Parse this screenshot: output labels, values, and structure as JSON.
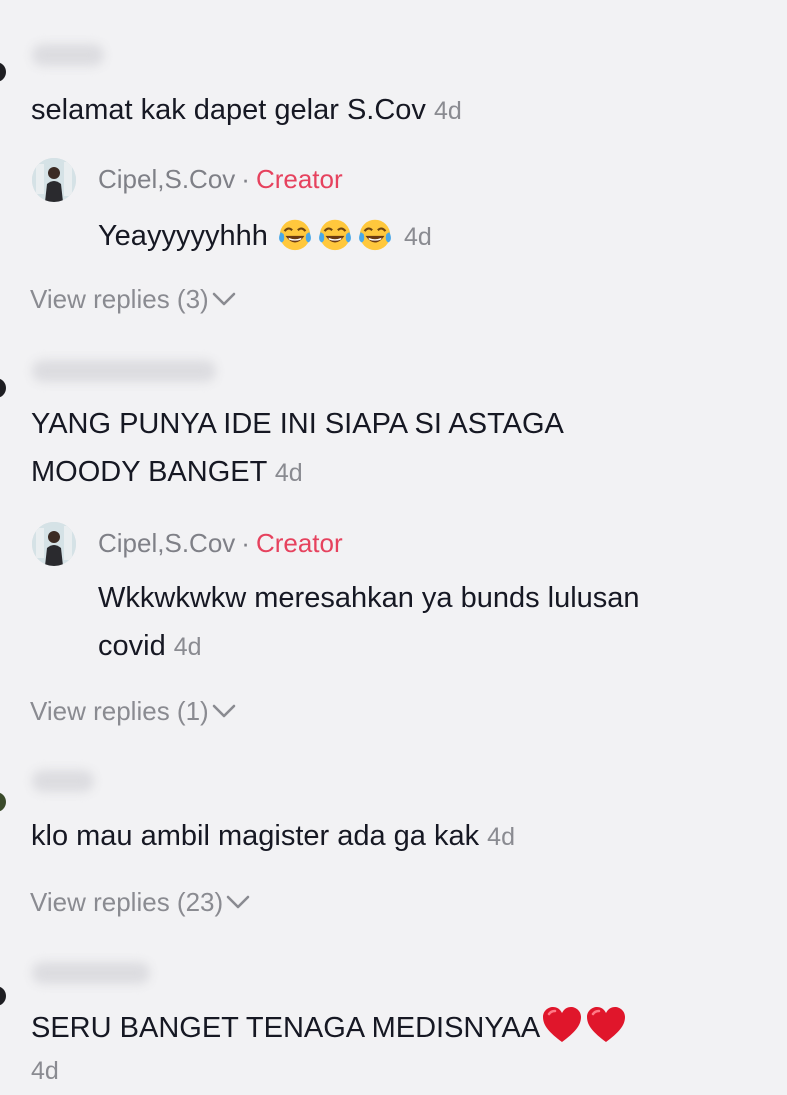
{
  "comments": [
    {
      "text": "selamat kak dapet gelar S.Cov",
      "time": "4d",
      "reply": {
        "author": "Cipel,S.Cov",
        "separator": "·",
        "badge": "Creator",
        "text": "Yeayyyyyhhh",
        "time": "4d"
      },
      "view_replies": "View replies (3)"
    },
    {
      "text_line1": "YANG PUNYA IDE INI SIAPA SI ASTAGA",
      "text_line2": "MOODY BANGET",
      "time": "4d",
      "reply": {
        "author": "Cipel,S.Cov",
        "separator": "·",
        "badge": "Creator",
        "text_line1": "Wkkwkwkw meresahkan ya bunds lulusan",
        "text_line2": "covid",
        "time": "4d"
      },
      "view_replies": "View replies (1)"
    },
    {
      "text": "klo mau ambil magister ada ga kak",
      "time": "4d",
      "view_replies": "View replies (23)"
    },
    {
      "text": "SERU BANGET TENAGA MEDISNYAA",
      "time": "4d"
    }
  ],
  "icons": {
    "emoji": "tears-of-joy-emoji",
    "heart": "red-heart-emoji",
    "chevron": "chevron-down-icon"
  },
  "colors": {
    "background": "#f2f2f4",
    "text": "#161823",
    "muted": "#8a8b91",
    "creator_badge": "#e6425e",
    "heart": "#e0162b"
  }
}
